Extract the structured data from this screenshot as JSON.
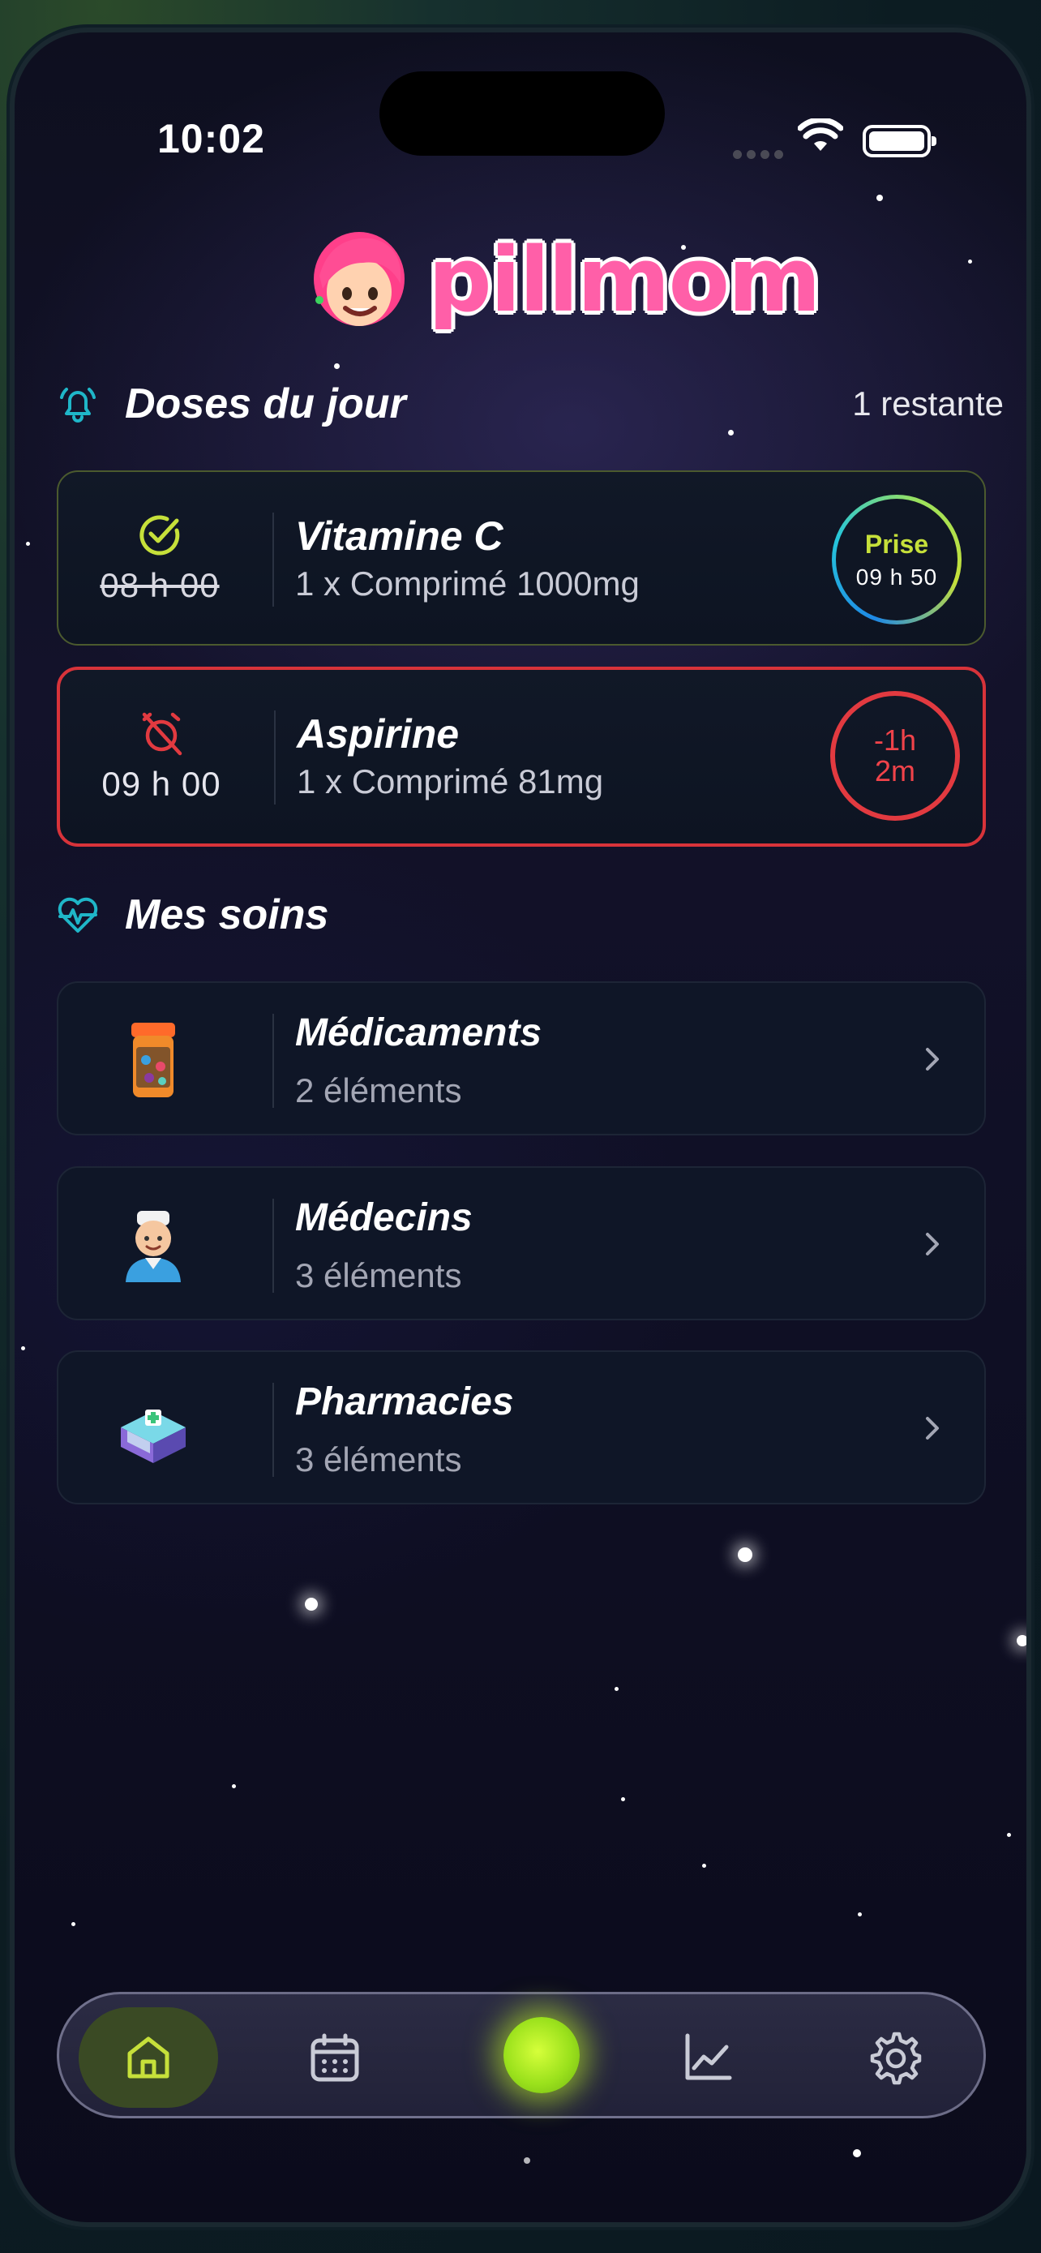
{
  "status_bar": {
    "time": "10:02"
  },
  "app": {
    "name": "pillmom"
  },
  "doses": {
    "title": "Doses du jour",
    "remaining": "1 restante",
    "items": [
      {
        "time": "08 h 00",
        "name": "Vitamine C",
        "detail": "1 x Comprimé 1000mg",
        "status_label": "Prise",
        "status_time": "09 h 50",
        "state": "taken"
      },
      {
        "time": "09 h 00",
        "name": "Aspirine",
        "detail": "1 x Comprimé 81mg",
        "status_label": "-1h\n2m",
        "state": "late"
      }
    ]
  },
  "care": {
    "title": "Mes soins",
    "items": [
      {
        "name": "Médicaments",
        "count": "2 éléments",
        "icon": "pill-bottle-icon"
      },
      {
        "name": "Médecins",
        "count": "3 éléments",
        "icon": "doctor-icon"
      },
      {
        "name": "Pharmacies",
        "count": "3 éléments",
        "icon": "pharmacy-icon"
      }
    ]
  },
  "tabbar": {
    "items": [
      "home-icon",
      "calendar-icon",
      "center-orb",
      "chart-icon",
      "settings-icon"
    ],
    "active": "home-icon"
  },
  "colors": {
    "accent_green": "#c6e03a",
    "alert_red": "#e23a40",
    "brand_pink": "#ff5fa8"
  }
}
